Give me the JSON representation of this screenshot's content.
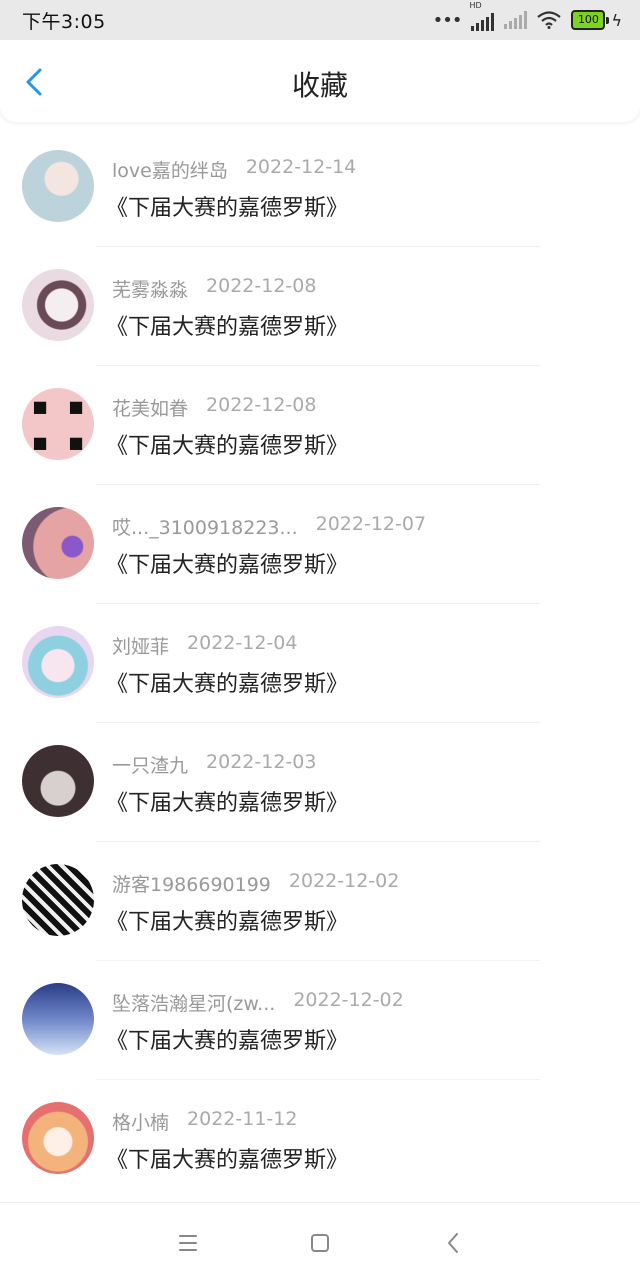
{
  "status_bar": {
    "time": "下午3:05",
    "network": "HD",
    "battery": "100"
  },
  "header": {
    "title": "收藏"
  },
  "items": [
    {
      "name": "love嘉的绊岛",
      "date": "2022-12-14",
      "title": "《下届大赛的嘉德罗斯》",
      "avatar_color": "#c8d8e0"
    },
    {
      "name": "芜雾淼淼",
      "date": "2022-12-08",
      "title": "《下届大赛的嘉德罗斯》",
      "avatar_color": "#e8d4dc"
    },
    {
      "name": "花美如眷",
      "date": "2022-12-08",
      "title": "《下届大赛的嘉德罗斯》",
      "avatar_color": "#f3c6c8"
    },
    {
      "name": "哎..._3100918223...",
      "date": "2022-12-07",
      "title": "《下届大赛的嘉德罗斯》",
      "avatar_color": "#d99a9a"
    },
    {
      "name": "刘娅菲",
      "date": "2022-12-04",
      "title": "《下届大赛的嘉德罗斯》",
      "avatar_color": "#c7d7ec"
    },
    {
      "name": "一只渣九",
      "date": "2022-12-03",
      "title": "《下届大赛的嘉德罗斯》",
      "avatar_color": "#8a7a76"
    },
    {
      "name": "游客1986690199",
      "date": "2022-12-02",
      "title": "《下届大赛的嘉德罗斯》",
      "avatar_color": "#2a2a2a"
    },
    {
      "name": "坠落浩瀚星河(zw...",
      "date": "2022-12-02",
      "title": "《下届大赛的嘉德罗斯》",
      "avatar_color": "#3f5fae"
    },
    {
      "name": "格小楠",
      "date": "2022-11-12",
      "title": "《下届大赛的嘉德罗斯》",
      "avatar_color": "#f1c29a"
    }
  ],
  "icons": {
    "back": "chevron-left-icon",
    "menu": "menu-icon",
    "home": "home-square-icon",
    "nav_back": "nav-back-icon"
  },
  "colors": {
    "accent": "#2196f3",
    "status_bar_bg": "#e9e9e9"
  }
}
